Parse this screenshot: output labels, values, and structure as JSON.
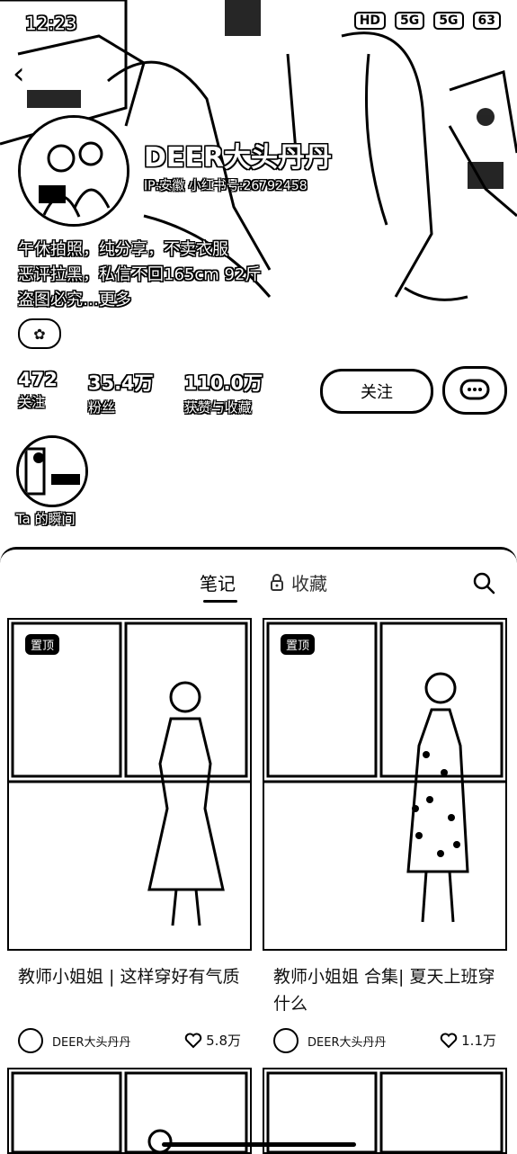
{
  "status_bar": {
    "time": "12:23",
    "icons": [
      "HD",
      "5G",
      "5G",
      "63"
    ]
  },
  "profile": {
    "name": "DEER大头丹丹",
    "red_id": "IP:安徽  小红书号:26792458",
    "bio": [
      "午休拍照，纯分享，不卖衣服",
      "恶评拉黑，私信不回165cm 92斤",
      "盗图必究…更多"
    ],
    "stats": [
      {
        "value": "472",
        "label": "关注"
      },
      {
        "value": "35.4万",
        "label": "粉丝"
      },
      {
        "value": "110.0万",
        "label": "获赞与收藏"
      }
    ],
    "follow_label": "关注",
    "moment_label": "Ta 的瞬间"
  },
  "tabs": {
    "notes": "笔记",
    "favorites": "收藏"
  },
  "posts": [
    {
      "pin": "置顶",
      "title": "教师小姐姐 | 这样穿好有气质",
      "author": "DEER大头丹丹",
      "likes": "5.8万"
    },
    {
      "pin": "置顶",
      "title": "教师小姐姐 合集| 夏天上班穿什么",
      "author": "DEER大头丹丹",
      "likes": "1.1万"
    }
  ]
}
